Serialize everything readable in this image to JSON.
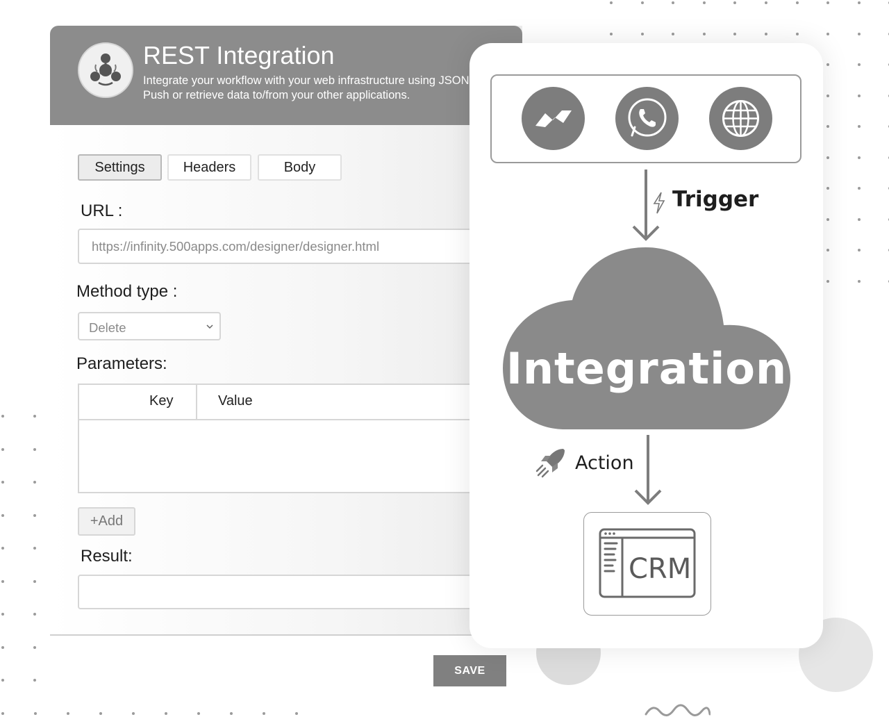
{
  "app": {
    "title": "REST Integration",
    "subtitle_line1": "Integrate your workflow with your web infrastructure using JSON",
    "subtitle_line2": "Push or retrieve data to/from your other applications."
  },
  "tabs": [
    {
      "label": "Settings",
      "active": true
    },
    {
      "label": "Headers",
      "active": false
    },
    {
      "label": "Body",
      "active": false
    }
  ],
  "form": {
    "url_label": "URL :",
    "url_value": "https://infinity.500apps.com/designer/designer.html",
    "method_label": "Method type :",
    "method_value": "Delete",
    "params_label": "Parameters:",
    "params_columns": [
      "Key",
      "Value"
    ],
    "add_label": "+Add",
    "result_label": "Result:",
    "result_value": ""
  },
  "actions": {
    "save_label": "SAVE"
  },
  "flow": {
    "channels": [
      {
        "icon": "messenger-icon"
      },
      {
        "icon": "whatsapp-icon"
      },
      {
        "icon": "globe-icon"
      }
    ],
    "trigger_label": "Trigger",
    "cloud_label": "Integration",
    "action_label": "Action",
    "target_label": "CRM"
  },
  "colors": {
    "header_bg": "#8c8c8c",
    "icon_circle": "#7d7d7d",
    "cloud": "#8a8a8a",
    "save_bg": "#808080"
  }
}
